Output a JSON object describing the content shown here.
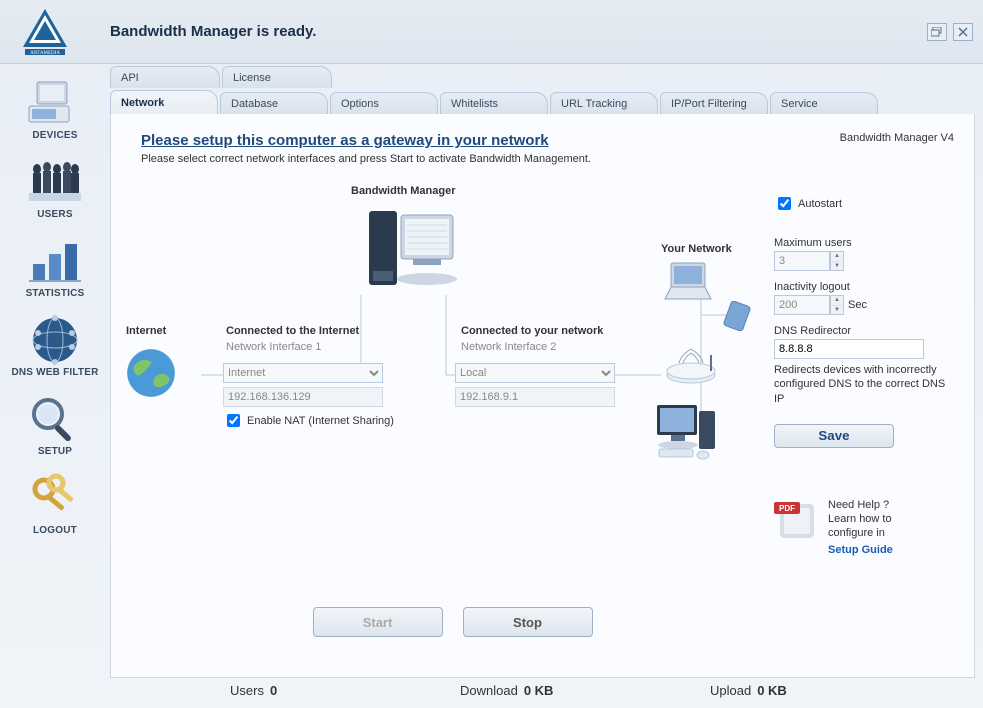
{
  "brand": "ANTAMEDIA",
  "title": "Bandwidth Manager is ready.",
  "sidebar": {
    "items": [
      {
        "label": "DEVICES"
      },
      {
        "label": "USERS"
      },
      {
        "label": "STATISTICS"
      },
      {
        "label": "DNS WEB FILTER"
      },
      {
        "label": "SETUP"
      },
      {
        "label": "LOGOUT"
      }
    ]
  },
  "tabsTop": [
    {
      "label": "API"
    },
    {
      "label": "License"
    }
  ],
  "tabsSub": [
    {
      "label": "Network"
    },
    {
      "label": "Database"
    },
    {
      "label": "Options"
    },
    {
      "label": "Whitelists"
    },
    {
      "label": "URL Tracking"
    },
    {
      "label": "IP/Port Filtering"
    },
    {
      "label": "Service"
    }
  ],
  "headline": "Please setup this computer as a gateway in your network",
  "subline": "Please select correct network interfaces and press Start to activate Bandwidth Management.",
  "diagram": {
    "bm_caption": "Bandwidth Manager",
    "internet_caption": "Internet",
    "yournetwork_caption": "Your Network",
    "if1": {
      "title": "Connected to the Internet",
      "sub": "Network Interface 1",
      "select": "Internet",
      "ip": "192.168.136.129",
      "nat_label": "Enable NAT (Internet Sharing)"
    },
    "if2": {
      "title": "Connected to your network",
      "sub": "Network Interface 2",
      "select": "Local",
      "ip": "192.168.9.1"
    }
  },
  "right": {
    "version": "Bandwidth Manager V4",
    "autostart_label": "Autostart",
    "maxusers_label": "Maximum users",
    "maxusers_value": "3",
    "inactivity_label": "Inactivity logout",
    "inactivity_value": "200",
    "inactivity_suffix": "Sec",
    "dns_label": "DNS Redirector",
    "dns_value": "8.8.8.8",
    "dns_hint": "Redirects devices with incorrectly configured DNS to the correct DNS IP",
    "save": "Save",
    "help_q": "Need Help ?",
    "help_line2": "Learn how to",
    "help_line3": "configure in",
    "help_link": "Setup Guide",
    "pdf_badge": "PDF"
  },
  "buttons": {
    "start": "Start",
    "stop": "Stop"
  },
  "status": {
    "users_label": "Users",
    "users_value": "0",
    "download_label": "Download",
    "download_value": "0 KB",
    "upload_label": "Upload",
    "upload_value": "0 KB"
  }
}
